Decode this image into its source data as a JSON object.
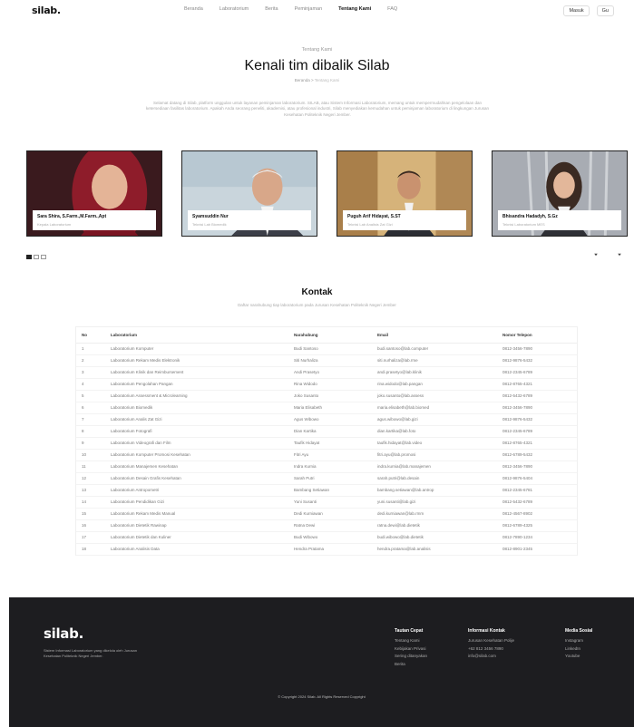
{
  "nav": {
    "logo": "silab.",
    "links": [
      "Beranda",
      "Laboratorium",
      "Berita",
      "Peminjaman",
      "Tentang Kami",
      "FAQ"
    ],
    "active": "Tentang Kami",
    "btn_masuk": "Masuk",
    "btn_lang": "Gu"
  },
  "hero": {
    "eyebrow": "Tentang Kami",
    "title": "Kenali tim dibalik Silab",
    "breadcrumb_home": "Beranda",
    "breadcrumb_sep": ">",
    "breadcrumb_current": "Tentang Kami",
    "description": "Selamat datang di Silab, platform unggulan untuk layanan peminjaman laboratorium. SILAB, atau Sistem Informasi Laboratorium, memang untuk mempermudahkan pengelolaan dan ketersediaan fasilitas laboratorium. Apakah Anda seorang peneliti, akademisi, atau profesional industri, Silab menyediakan kemudahan untuk peminjaman laboratorium di lingkungan Jurusan Kesehatan Politeknik Negeri Jember."
  },
  "team": [
    {
      "name": "Sara Shira, S.Farm.,M.Farm.,Apt",
      "role": "Kepala Laboratorium",
      "photo": "woman-hijab"
    },
    {
      "name": "Syamsuddin Nur",
      "role": "Teknisi Lab Biomedik",
      "photo": "older-man"
    },
    {
      "name": "Puguh Arif Hidayat, S.ST",
      "role": "Teknisi Lab Analisis Zat Gizi",
      "photo": "man-suit"
    },
    {
      "name": "Bhisandra Hadadyh, S.Gz",
      "role": "Teknisi Laboratorium MES",
      "photo": "woman-dark-hair"
    }
  ],
  "carousel": {
    "prev_icon": "chevron-down-icon",
    "next_icon": "chevron-down-icon"
  },
  "contact": {
    "title": "Kontak",
    "subtitle": "Daftar narahubung tiap laboratorium pada Jurusan Kesehatan Politeknik Negeri Jember",
    "headers": [
      "No",
      "Laboratorium",
      "Narahubung",
      "Email",
      "Nomor Telepon"
    ],
    "rows": [
      [
        "1",
        "Laboratorium Komputer",
        "Budi Santoso",
        "budi.santoso@lab.computer",
        "0812-3456-7890"
      ],
      [
        "2",
        "Laboratorium Rekam Medis Elektronik",
        "Siti Nurhaliza",
        "siti.nurhaliza@lab.rme",
        "0812-9876-5432"
      ],
      [
        "3",
        "Laboratorium Klinik dan Reimbursement",
        "Andi Prasetyo",
        "andi.prasetyo@lab.klinik",
        "0812-2345-6789"
      ],
      [
        "4",
        "Laboratorium Pengolahan Pangan",
        "Rina Widodo",
        "rina.widodo@lab.pangan",
        "0812-8765-4321"
      ],
      [
        "5",
        "Laboratorium Assessment & Microlearning",
        "Joko Susanto",
        "joko.susanto@lab.assess",
        "0812-5432-6789"
      ],
      [
        "6",
        "Laboratorium Biomedik",
        "Maria Elisabeth",
        "maria.elisabeth@lab.biomed",
        "0812-3456-7890"
      ],
      [
        "7",
        "Laboratorium Analis Zat Gizi",
        "Agus Wibowo",
        "agus.wibowo@lab.gizi",
        "0812-9876-5432"
      ],
      [
        "8",
        "Laboratorium Fotografi",
        "Dian Kartika",
        "dian.kartika@lab.foto",
        "0812-2345-6789"
      ],
      [
        "9",
        "Laboratorium Videografi dan Film",
        "Taufik Hidayat",
        "taufik.hidayat@lab.video",
        "0812-8765-4321"
      ],
      [
        "10",
        "Laboratorium Komputer Promosi Kesehatan",
        "Fitri Ayu",
        "fitri.ayu@lab.promosi",
        "0812-6789-5432"
      ],
      [
        "11",
        "Laboratorium Manajemen Kesehatan",
        "Indra Kurnia",
        "indra.kurnia@lab.manajemen",
        "0812-3456-7890"
      ],
      [
        "12",
        "Laboratorium Desain Grafis Kesehatan",
        "Sarah Putri",
        "sarah.putri@lab.desain",
        "0812-9876-5404"
      ],
      [
        "13",
        "Laboratorium Antropometri",
        "Bambang Setiawan",
        "bambang.setiawan@lab.antrop",
        "0812-2345-6781"
      ],
      [
        "14",
        "Laboratorium Pendidikan Gizi",
        "Yuni Susanti",
        "yuni.susanti@lab.gizi",
        "0812-5432-6789"
      ],
      [
        "15",
        "Laboratorium Rekam Medis Manual",
        "Dedi Kurniawan",
        "dedi.kurniawan@lab.rmm",
        "0812-4567-8902"
      ],
      [
        "16",
        "Laboratorium Dietetik Rawinap",
        "Ratna Dewi",
        "ratna.dewi@lab.dietetik",
        "0812-6789-4325"
      ],
      [
        "17",
        "Laboratorium Dietetik dan Kuliner",
        "Budi Wibowo",
        "budi.wibowo@lab.dietetik",
        "0812-7890-1234"
      ],
      [
        "18",
        "Laboratorium Analisis Data",
        "Hendra Pratama",
        "hendra.pratama@lab.analisis",
        "0812-8901-2345"
      ]
    ]
  },
  "footer": {
    "logo": "silab.",
    "description": "Sistem Informasi Laboratorium yang dikelola oleh Jurusan Kesehatan Politeknik Negeri Jember.",
    "col1_title": "Tautan Cepat",
    "col1_items": [
      "Tentang Kami",
      "Kebijakan Privasi",
      "Sering ditanyakan",
      "Berita"
    ],
    "col2_title": "Informasi Kontak",
    "col2_items": [
      "Jurusan Kesehatan Polije",
      "+62 812 3456 7890",
      "info@silab.com"
    ],
    "col3_title": "Media Sosial",
    "col3_items": [
      "Instagram",
      "LinkedIn",
      "Youtube"
    ],
    "copyright": "© Copyright 2024 Silab. All Rights Reserved Copyright"
  }
}
